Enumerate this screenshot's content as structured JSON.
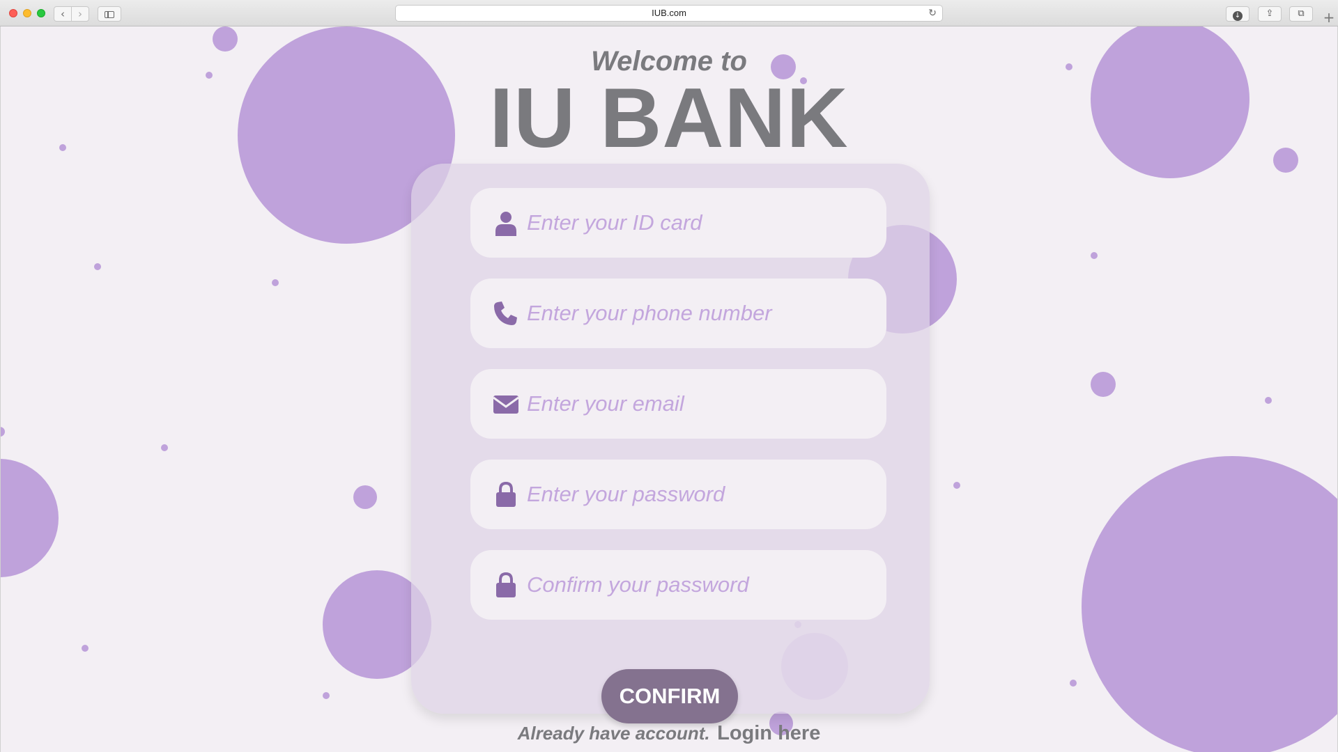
{
  "browser": {
    "url": "IUB.com",
    "back_glyph": "‹",
    "forward_glyph": "›",
    "reload_glyph": "↻",
    "download_glyph": "↓",
    "share_glyph": "⇪",
    "tabs_glyph": "⧉",
    "newtab_glyph": "+"
  },
  "header": {
    "welcome": "Welcome to",
    "brand": "IU BANK"
  },
  "form": {
    "fields": [
      {
        "placeholder": "Enter your ID card",
        "icon": "user-icon"
      },
      {
        "placeholder": "Enter your phone number",
        "icon": "phone-icon"
      },
      {
        "placeholder": "Enter your email",
        "icon": "envelope-icon"
      },
      {
        "placeholder": "Enter your password",
        "icon": "lock-icon"
      },
      {
        "placeholder": "Confirm your password",
        "icon": "lock-icon"
      }
    ],
    "confirm_label": "CONFIRM"
  },
  "footer": {
    "text": "Already have account.",
    "link": "Login here"
  },
  "colors": {
    "background": "#f3eff4",
    "bubble": "#bfa2db",
    "card": "#ded2e6",
    "icon": "#8a6aa8",
    "placeholder": "#c3a6dd",
    "button": "#84728f",
    "heading": "#7a7a7e"
  }
}
